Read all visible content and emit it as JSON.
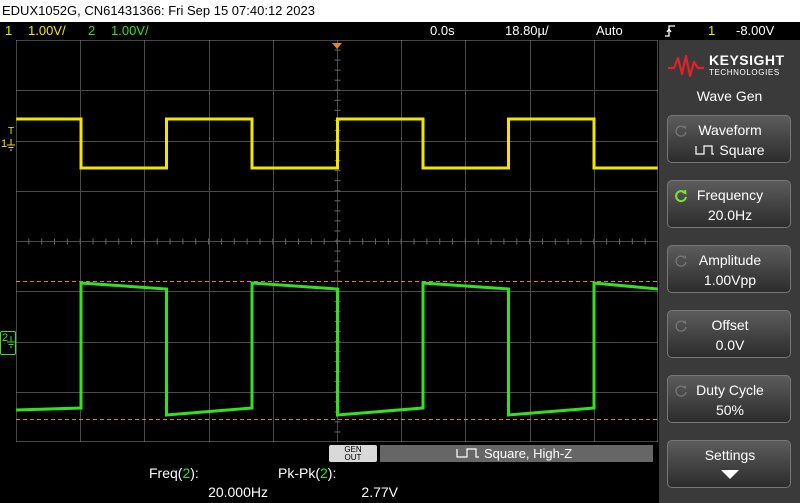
{
  "title": "EDUX1052G, CN61431366: Fri Sep 15 07:40:12 2023",
  "status": {
    "ch1_num": "1",
    "ch1_scale": "1.00V/",
    "ch2_num": "2",
    "ch2_scale": "1.00V/",
    "delay": "0.0s",
    "timebase": "18.80µ/",
    "mode": "Auto",
    "trigger_icon": "trigger-rising-edge-icon",
    "trigger_channel": "1",
    "trigger_level": "-8.00V"
  },
  "markers": {
    "trig_t": "T",
    "ch1": "1",
    "ch2": "2"
  },
  "colors": {
    "ch1": "#f2e600",
    "ch2": "#35e020",
    "grid": "#4a4a4a",
    "cursor": "#e07a3a"
  },
  "panel": {
    "brand": "KEYSIGHT",
    "brand_sub": "TECHNOLOGIES",
    "title": "Wave Gen",
    "softkeys": [
      {
        "label": "Waveform",
        "value": "Square",
        "icon": "square-wave-icon"
      },
      {
        "label": "Frequency",
        "value": "20.0Hz",
        "active": true
      },
      {
        "label": "Amplitude",
        "value": "1.00Vpp"
      },
      {
        "label": "Offset",
        "value": "0.0V"
      },
      {
        "label": "Duty Cycle",
        "value": "50%"
      },
      {
        "label": "Settings",
        "icon": "arrow-down-icon"
      }
    ]
  },
  "bottom": {
    "genout_l1": "GEN",
    "genout_l2": "OUT",
    "wavegen_status": "Square, High-Z",
    "meas1_label": "Freq(",
    "meas1_ch": "2",
    "meas1_close": "):",
    "meas1_value": "20.000Hz",
    "meas2_label": "Pk-Pk(",
    "meas2_ch": "2",
    "meas2_close": "):",
    "meas2_value": "2.77V"
  }
}
